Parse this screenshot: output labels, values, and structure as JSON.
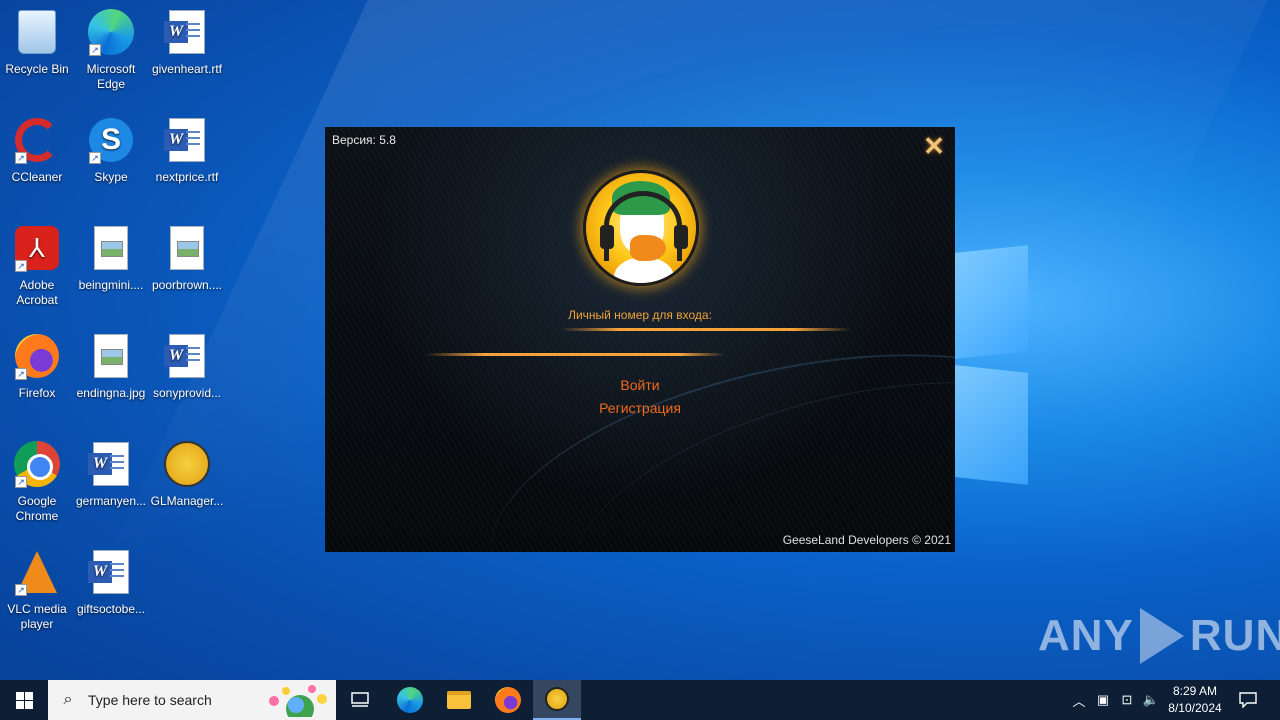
{
  "desktop": {
    "icons": [
      {
        "label": "Recycle Bin",
        "icon": "recycle-bin-icon"
      },
      {
        "label": "Microsoft Edge",
        "icon": "edge-icon"
      },
      {
        "label": "givenheart.rtf",
        "icon": "word-doc-icon"
      },
      {
        "label": "CCleaner",
        "icon": "ccleaner-icon"
      },
      {
        "label": "Skype",
        "icon": "skype-icon"
      },
      {
        "label": "nextprice.rtf",
        "icon": "word-doc-icon"
      },
      {
        "label": "Adobe Acrobat",
        "icon": "acrobat-icon"
      },
      {
        "label": "beingmini....",
        "icon": "image-file-icon"
      },
      {
        "label": "poorbrown....",
        "icon": "image-file-icon"
      },
      {
        "label": "Firefox",
        "icon": "firefox-icon"
      },
      {
        "label": "endingna.jpg",
        "icon": "image-file-icon"
      },
      {
        "label": "sonyprovid...",
        "icon": "word-doc-icon"
      },
      {
        "label": "Google Chrome",
        "icon": "chrome-icon"
      },
      {
        "label": "germanyen...",
        "icon": "word-doc-icon"
      },
      {
        "label": "GLManager...",
        "icon": "glmanager-icon"
      },
      {
        "label": "VLC media player",
        "icon": "vlc-icon"
      },
      {
        "label": "giftsoctobe...",
        "icon": "word-doc-icon"
      }
    ]
  },
  "app": {
    "version": "Версия: 5.8",
    "close_glyph": "✕",
    "field_label": "Личный номер для входа:",
    "field_value": "",
    "login_label": "Войти",
    "register_label": "Регистрация",
    "copyright": "GeeseLand Developers © 2021",
    "accent_color": "#f26a1b"
  },
  "watermark": {
    "left": "ANY",
    "right": "RUN"
  },
  "taskbar": {
    "search_placeholder": "Type here to search",
    "time": "8:29 AM",
    "date": "8/10/2024",
    "pinned": [
      "task-view-icon",
      "edge-icon",
      "file-explorer-icon",
      "firefox-icon",
      "glmanager-icon"
    ]
  }
}
